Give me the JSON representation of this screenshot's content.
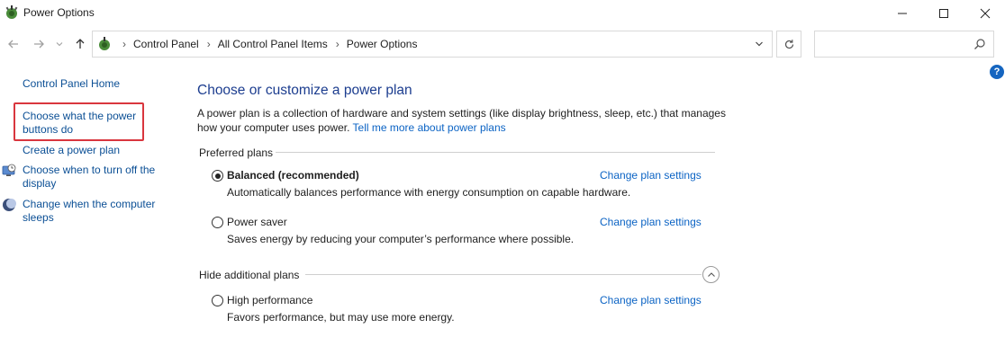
{
  "window": {
    "title": "Power Options",
    "controls": {
      "minimize": "minimize",
      "maximize": "maximize",
      "close": "close"
    }
  },
  "address_bar": {
    "breadcrumbs": [
      "Control Panel",
      "All Control Panel Items",
      "Power Options"
    ],
    "search_value": "",
    "search_placeholder": ""
  },
  "sidebar": {
    "home": "Control Panel Home",
    "items": [
      {
        "label": "Choose what the power buttons do",
        "icon": "none",
        "highlighted": true
      },
      {
        "label": "Create a power plan",
        "icon": "none"
      },
      {
        "label": "Choose when to turn off the display",
        "icon": "display-clock-icon"
      },
      {
        "label": "Change when the computer sleeps",
        "icon": "moon-icon"
      }
    ]
  },
  "main": {
    "title": "Choose or customize a power plan",
    "description": "A power plan is a collection of hardware and system settings (like display brightness, sleep, etc.) that manages how your computer uses power.",
    "learn_more_link": "Tell me more about power plans",
    "preferred_label": "Preferred plans",
    "hidden_label": "Hide additional plans",
    "plans": [
      {
        "name": "Balanced (recommended)",
        "description": "Automatically balances performance with energy consumption on capable hardware.",
        "selected": true,
        "link": "Change plan settings"
      },
      {
        "name": "Power saver",
        "description": "Saves energy by reducing your computer’s performance where possible.",
        "selected": false,
        "link": "Change plan settings"
      },
      {
        "name": "High performance",
        "description": "Favors performance, but may use more energy.",
        "selected": false,
        "link": "Change plan settings"
      }
    ]
  },
  "colors": {
    "link": "#0b63c4",
    "title": "#1c3d8f",
    "highlight_border": "#d9363e",
    "help_badge": "#1565c0"
  },
  "help_label": "?"
}
